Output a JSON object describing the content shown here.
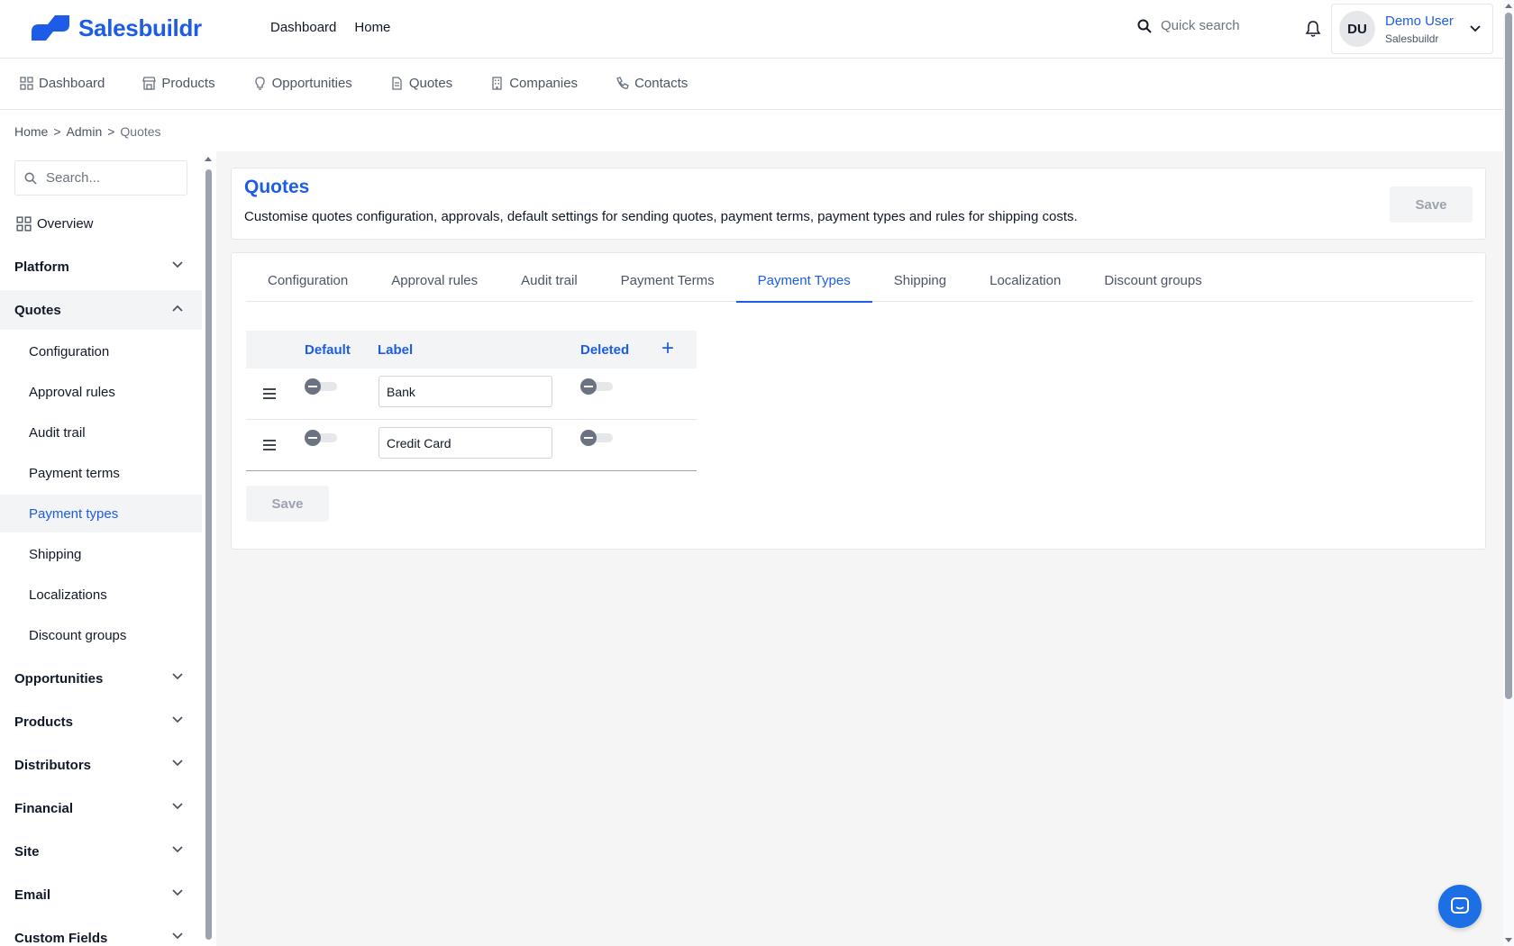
{
  "brand": {
    "name": "Salesbuildr",
    "color": "#1d5ce6"
  },
  "top_links": [
    "Dashboard",
    "Home"
  ],
  "quick_search": {
    "placeholder": "Quick search"
  },
  "user": {
    "initials": "DU",
    "name": "Demo User",
    "org": "Salesbuildr"
  },
  "modules": [
    {
      "label": "Dashboard",
      "icon": "grid-icon"
    },
    {
      "label": "Products",
      "icon": "store-icon"
    },
    {
      "label": "Opportunities",
      "icon": "lightbulb-icon"
    },
    {
      "label": "Quotes",
      "icon": "document-icon"
    },
    {
      "label": "Companies",
      "icon": "building-icon"
    },
    {
      "label": "Contacts",
      "icon": "phone-icon"
    }
  ],
  "breadcrumb": {
    "home": "Home",
    "admin": "Admin",
    "current": "Quotes",
    "separator": ">"
  },
  "sidebar": {
    "search_placeholder": "Search...",
    "overview": "Overview",
    "sections": {
      "platform": "Platform",
      "quotes": "Quotes",
      "opportunities": "Opportunities",
      "products": "Products",
      "distributors": "Distributors",
      "financial": "Financial",
      "site": "Site",
      "email": "Email",
      "custom_fields": "Custom Fields"
    },
    "quotes_items": [
      "Configuration",
      "Approval rules",
      "Audit trail",
      "Payment terms",
      "Payment types",
      "Shipping",
      "Localizations",
      "Discount groups"
    ],
    "active_item": "Payment types"
  },
  "page": {
    "title": "Quotes",
    "description": "Customise quotes configuration, approvals, default settings for sending quotes, payment terms, payment types and rules for shipping costs.",
    "save_label": "Save"
  },
  "tabs": [
    "Configuration",
    "Approval rules",
    "Audit trail",
    "Payment Terms",
    "Payment Types",
    "Shipping",
    "Localization",
    "Discount groups"
  ],
  "active_tab": "Payment Types",
  "payment_types": {
    "headers": {
      "default": "Default",
      "label": "Label",
      "deleted": "Deleted",
      "add": "+"
    },
    "rows": [
      {
        "default": false,
        "label": "Bank",
        "deleted": false
      },
      {
        "default": false,
        "label": "Credit Card",
        "deleted": false
      }
    ],
    "save_label": "Save"
  }
}
